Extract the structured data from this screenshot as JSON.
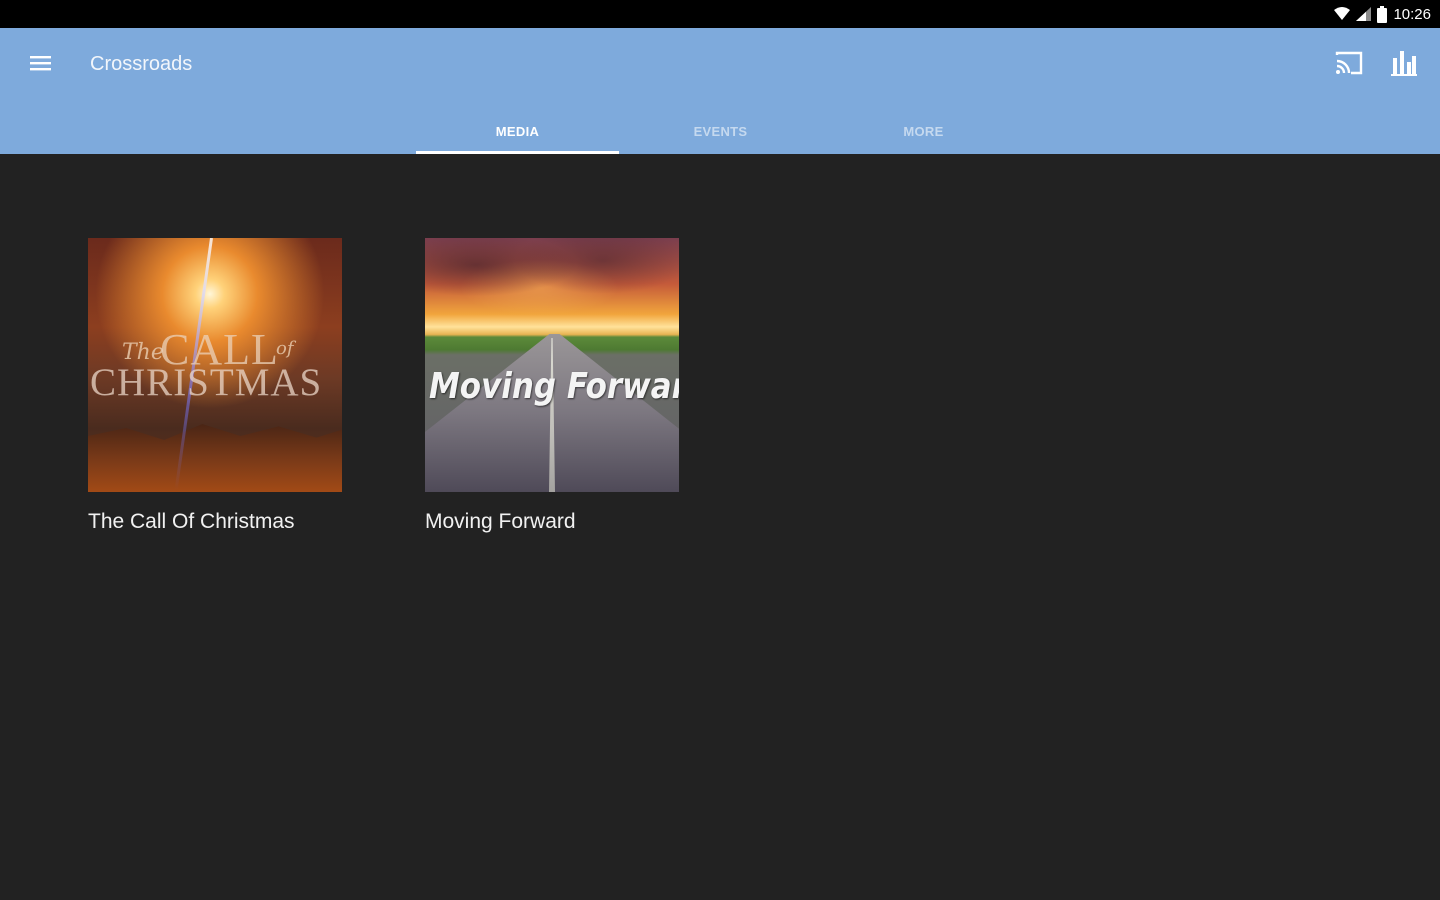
{
  "status_bar": {
    "time": "10:26",
    "icons": [
      "wifi-icon",
      "cell-signal-icon",
      "battery-icon"
    ]
  },
  "app_bar": {
    "title": "Crossroads",
    "background_color": "#7eaadc",
    "icons": [
      "menu-icon",
      "cast-icon",
      "bar-chart-icon"
    ]
  },
  "tabs": [
    {
      "label": "MEDIA",
      "active": true
    },
    {
      "label": "EVENTS",
      "active": false
    },
    {
      "label": "MORE",
      "active": false
    }
  ],
  "media": {
    "items": [
      {
        "caption": "The Call Of Christmas",
        "art_text": {
          "the": "The",
          "call": "CALL",
          "of": "of",
          "christmas": "CHRISTMAS"
        }
      },
      {
        "caption": "Moving Forward",
        "art_text": {
          "title": "Moving Forward"
        }
      }
    ]
  },
  "colors": {
    "background": "#222222",
    "status_bar": "#000000",
    "tab_indicator": "#ffffff"
  }
}
